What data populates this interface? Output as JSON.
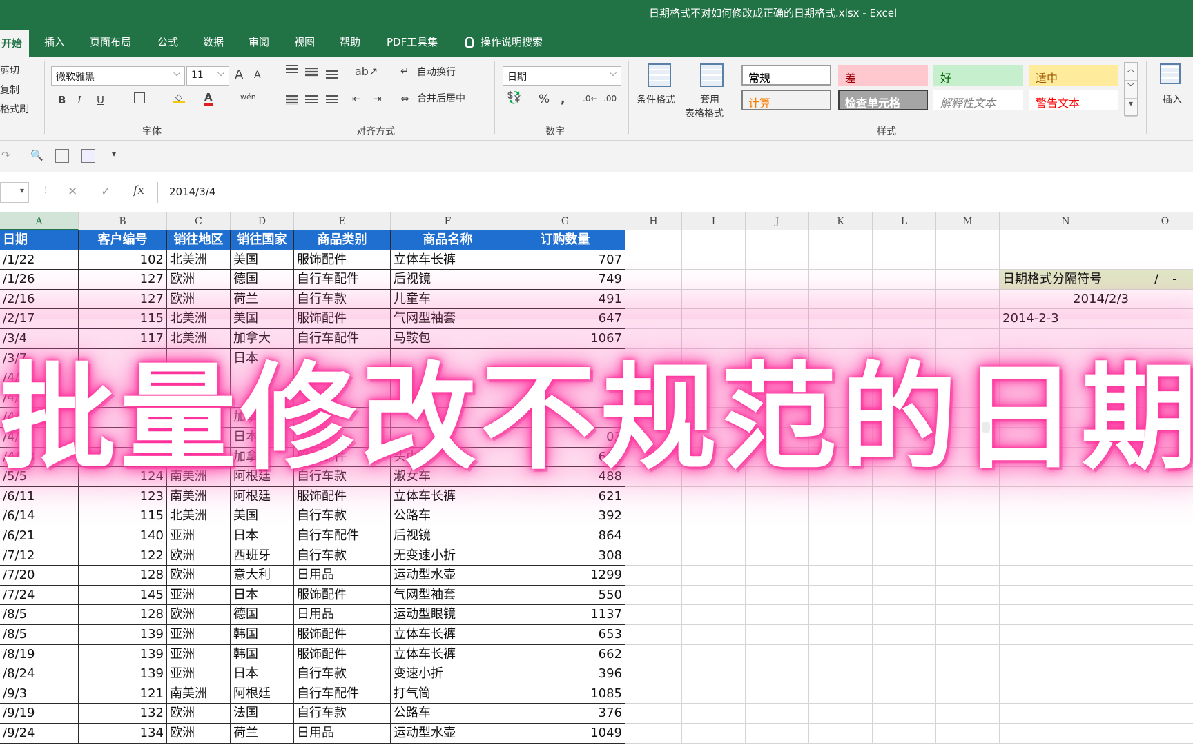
{
  "window": {
    "title": "日期格式不对如何修改成正确的日期格式.xlsx  -  Excel"
  },
  "tabs": [
    {
      "label": "开始"
    },
    {
      "label": "插入"
    },
    {
      "label": "页面布局"
    },
    {
      "label": "公式"
    },
    {
      "label": "数据"
    },
    {
      "label": "审阅"
    },
    {
      "label": "视图"
    },
    {
      "label": "帮助"
    },
    {
      "label": "PDF工具集"
    }
  ],
  "tell_me": "操作说明搜索",
  "clipboard": {
    "cut": "剪切",
    "copy": "复制",
    "format_painter": "格式刷"
  },
  "font": {
    "name": "微软雅黑",
    "size": "11",
    "group_label": "字体",
    "grow": "A",
    "shrink": "A",
    "bold": "B",
    "italic": "I",
    "underline": "U",
    "font_color": "A",
    "phonetic": "wén"
  },
  "alignment": {
    "wrap_text": "自动换行",
    "merge_center": "合并后居中",
    "group_label": "对齐方式"
  },
  "number": {
    "format": "日期",
    "percent": "%",
    "comma": ",",
    "inc_decimal": ".0←",
    "dec_decimal": ".00",
    "group_label": "数字"
  },
  "styles": {
    "conditional": "条件格式",
    "table_top": "套用",
    "table_bottom": "表格格式",
    "group_label": "样式",
    "cells": [
      {
        "label": "常规",
        "bg": "#ffffff",
        "color": "#000000",
        "border": "#9c9c9c"
      },
      {
        "label": "差",
        "bg": "#ffc7ce",
        "color": "#9c0006",
        "border": "#ffc7ce"
      },
      {
        "label": "好",
        "bg": "#c6efce",
        "color": "#006100",
        "border": "#c6efce"
      },
      {
        "label": "适中",
        "bg": "#ffeb9c",
        "color": "#9c5700",
        "border": "#ffeb9c"
      },
      {
        "label": "计算",
        "bg": "#f2f2f2",
        "color": "#fa7d00",
        "border": "#7f7f7f"
      },
      {
        "label": "检查单元格",
        "bg": "#a5a5a5",
        "color": "#ffffff",
        "border": "#3f3f3f"
      },
      {
        "label": "解释性文本",
        "bg": "#ffffff",
        "color": "#7f7f7f",
        "border": "#ffffff"
      },
      {
        "label": "警告文本",
        "bg": "#ffffff",
        "color": "#ff0000",
        "border": "#ffffff"
      }
    ]
  },
  "cells_group": {
    "insert": "插入"
  },
  "formula_bar": {
    "content": "2014/3/4",
    "cancel": "✕",
    "enter": "✓",
    "fx": "fx"
  },
  "columns": [
    "A",
    "B",
    "C",
    "D",
    "E",
    "F",
    "G",
    "H",
    "I",
    "J",
    "K",
    "L",
    "M",
    "N",
    "O"
  ],
  "table": {
    "headers": [
      "日期",
      "客户编号",
      "销往地区",
      "销往国家",
      "商品类别",
      "商品名称",
      "订购数量"
    ],
    "rows": [
      [
        "/1/22",
        "102",
        "北美洲",
        "美国",
        "服饰配件",
        "立体车长裤",
        "707"
      ],
      [
        "/1/26",
        "127",
        "欧洲",
        "德国",
        "自行车配件",
        "后视镜",
        "749"
      ],
      [
        "/2/16",
        "127",
        "欧洲",
        "荷兰",
        "自行车款",
        "儿童车",
        "491"
      ],
      [
        "/2/17",
        "115",
        "北美洲",
        "美国",
        "服饰配件",
        "气网型袖套",
        "647"
      ],
      [
        "/3/4",
        "117",
        "北美洲",
        "加拿大",
        "自行车配件",
        "马鞍包",
        "1067"
      ],
      [
        "/3/7",
        "",
        "",
        "日本",
        "",
        "",
        ""
      ],
      [
        "/4/",
        "",
        "",
        "",
        "",
        "",
        ""
      ],
      [
        "/4/5",
        "",
        "",
        "",
        "",
        "",
        ""
      ],
      [
        "/4/",
        "",
        "",
        "加拿",
        "",
        "",
        ""
      ],
      [
        "/4/2",
        "",
        "",
        "日本",
        "",
        "",
        "03"
      ],
      [
        "/4/28",
        "120",
        "北美洲",
        "加拿大",
        "服饰配件",
        "头巾",
        "686"
      ],
      [
        "/5/5",
        "124",
        "南美洲",
        "阿根廷",
        "自行车款",
        "淑女车",
        "488"
      ],
      [
        "/6/11",
        "123",
        "南美洲",
        "阿根廷",
        "服饰配件",
        "立体车长裤",
        "621"
      ],
      [
        "/6/14",
        "115",
        "北美洲",
        "美国",
        "自行车款",
        "公路车",
        "392"
      ],
      [
        "/6/21",
        "140",
        "亚洲",
        "日本",
        "自行车配件",
        "后视镜",
        "864"
      ],
      [
        "/7/12",
        "122",
        "欧洲",
        "西班牙",
        "自行车款",
        "无变速小折",
        "308"
      ],
      [
        "/7/20",
        "128",
        "欧洲",
        "意大利",
        "日用品",
        "运动型水壶",
        "1299"
      ],
      [
        "/7/24",
        "145",
        "亚洲",
        "日本",
        "服饰配件",
        "气网型袖套",
        "550"
      ],
      [
        "/8/5",
        "128",
        "欧洲",
        "德国",
        "日用品",
        "运动型眼镜",
        "1137"
      ],
      [
        "/8/5",
        "139",
        "亚洲",
        "韩国",
        "服饰配件",
        "立体车长裤",
        "653"
      ],
      [
        "/8/19",
        "139",
        "亚洲",
        "韩国",
        "服饰配件",
        "立体车长裤",
        "662"
      ],
      [
        "/8/24",
        "139",
        "亚洲",
        "日本",
        "自行车款",
        "变速小折",
        "396"
      ],
      [
        "/9/3",
        "121",
        "南美洲",
        "阿根廷",
        "自行车配件",
        "打气筒",
        "1085"
      ],
      [
        "/9/19",
        "132",
        "欧洲",
        "法国",
        "自行车款",
        "公路车",
        "376"
      ],
      [
        "/9/24",
        "134",
        "欧洲",
        "荷兰",
        "日用品",
        "运动型水壶",
        "1049"
      ]
    ]
  },
  "side": {
    "separator_label": "日期格式分隔符号",
    "slash": "/",
    "dash": "-",
    "example_slash": "2014/2/3",
    "example_dash": "2014-2-3"
  },
  "overlay": {
    "text": "批量修改不规范的日期"
  }
}
